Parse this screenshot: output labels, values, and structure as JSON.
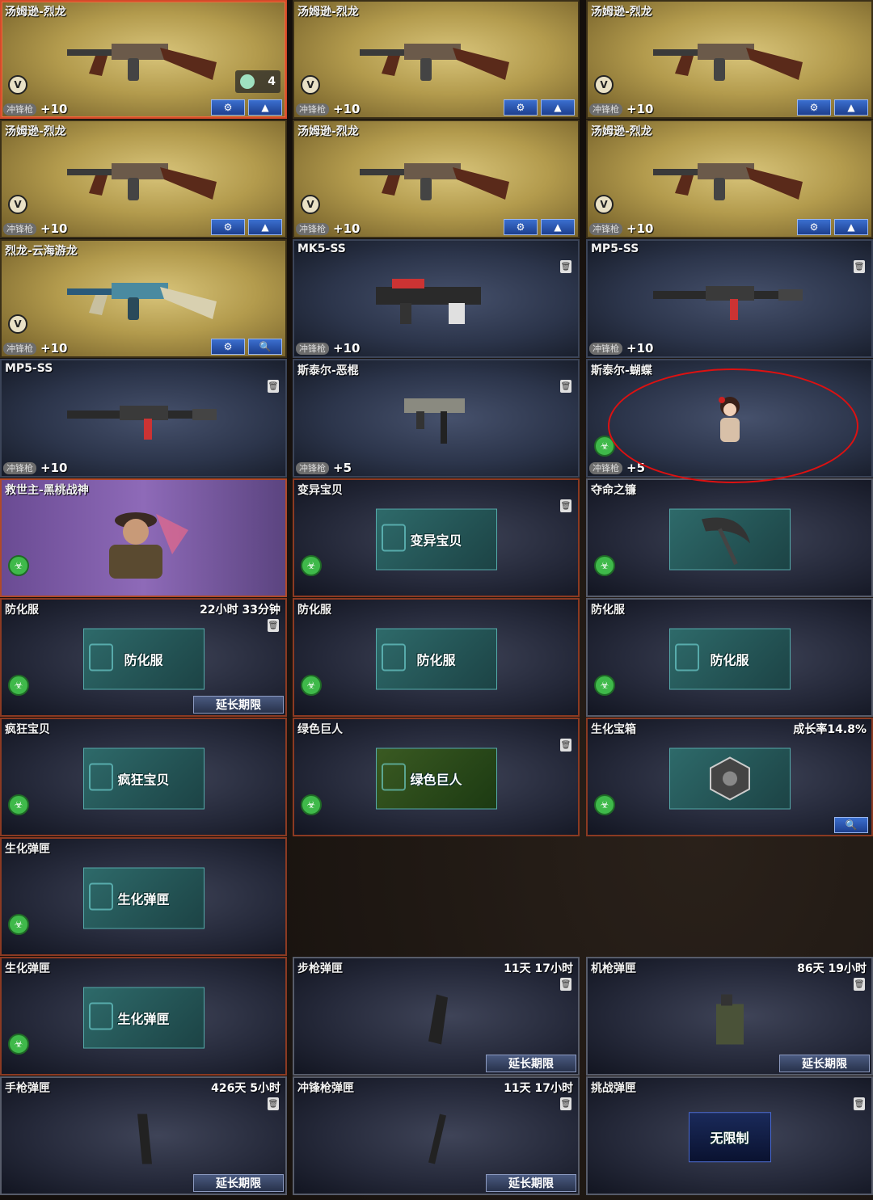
{
  "cards": [
    {
      "id": "c1",
      "title": "汤姆逊-烈龙",
      "tag": "冲锋枪",
      "level": "+10",
      "count": "4"
    },
    {
      "id": "c2",
      "title": "汤姆逊-烈龙",
      "tag": "冲锋枪",
      "level": "+10"
    },
    {
      "id": "c3",
      "title": "汤姆逊-烈龙",
      "tag": "冲锋枪",
      "level": "+10"
    },
    {
      "id": "c4",
      "title": "汤姆逊-烈龙",
      "tag": "冲锋枪",
      "level": "+10"
    },
    {
      "id": "c5",
      "title": "汤姆逊-烈龙",
      "tag": "冲锋枪",
      "level": "+10"
    },
    {
      "id": "c6",
      "title": "汤姆逊-烈龙",
      "tag": "冲锋枪",
      "level": "+10"
    },
    {
      "id": "c7",
      "title": "烈龙-云海游龙",
      "tag": "冲锋枪",
      "level": "+10"
    },
    {
      "id": "c8",
      "title": "MK5-SS",
      "tag": "冲锋枪",
      "level": "+10"
    },
    {
      "id": "c9",
      "title": "MP5-SS",
      "tag": "冲锋枪",
      "level": "+10"
    },
    {
      "id": "c10",
      "title": "MP5-SS",
      "tag": "冲锋枪",
      "level": "+10"
    },
    {
      "id": "c11",
      "title": "斯泰尔-恶棍",
      "tag": "冲锋枪",
      "level": "+5"
    },
    {
      "id": "c12",
      "title": "斯泰尔-蝴蝶",
      "tag": "冲锋枪",
      "level": "+5"
    },
    {
      "id": "c13",
      "title": "救世主-黑桃战神"
    },
    {
      "id": "c14",
      "title": "变异宝贝",
      "panel": "变异宝贝"
    },
    {
      "id": "c15",
      "title": "夺命之镰"
    },
    {
      "id": "c16",
      "title": "防化服",
      "panel": "防化服",
      "right": "22小时 33分钟",
      "extend": "延长期限"
    },
    {
      "id": "c17",
      "title": "防化服",
      "panel": "防化服"
    },
    {
      "id": "c18",
      "title": "防化服",
      "panel": "防化服"
    },
    {
      "id": "c19",
      "title": "疯狂宝贝",
      "panel": "疯狂宝贝"
    },
    {
      "id": "c20",
      "title": "绿色巨人",
      "panel": "绿色巨人"
    },
    {
      "id": "c21",
      "title": "生化宝箱",
      "right": "成长率14.8%"
    },
    {
      "id": "c22",
      "title": "生化弹匣",
      "panel": "生化弹匣"
    },
    {
      "id": "c23",
      "title": "生化弹匣",
      "panel": "生化弹匣"
    },
    {
      "id": "c24",
      "title": "步枪弹匣",
      "right": "11天 17小时",
      "extend": "延长期限"
    },
    {
      "id": "c25",
      "title": "机枪弹匣",
      "right": "86天 19小时",
      "extend": "延长期限"
    },
    {
      "id": "c26",
      "title": "手枪弹匣",
      "right": "426天 5小时",
      "extend": "延长期限"
    },
    {
      "id": "c27",
      "title": "冲锋枪弹匣",
      "right": "11天 17小时",
      "extend": "延长期限"
    },
    {
      "id": "c28",
      "title": "挑战弹匣",
      "panel": "无限制"
    }
  ],
  "icons": {
    "v_badge": "V",
    "bio_badge": "bio-icon",
    "upgrade": "wrench-icon",
    "up": "arrow-up-icon",
    "search": "magnifier-icon",
    "trash": "trash-icon"
  },
  "colors": {
    "gold_card": "#b39b4d",
    "blue_card": "#2c354b",
    "accent_border": "#d44a2a",
    "button_blue": "#2b5bb8",
    "bio_green": "#3fb94a"
  }
}
